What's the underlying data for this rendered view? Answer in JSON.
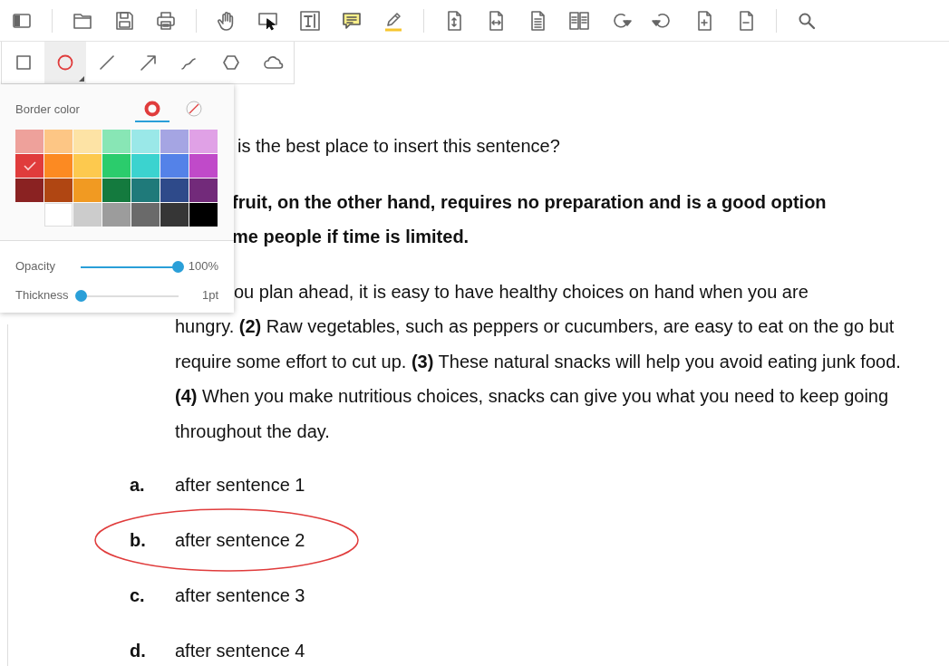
{
  "shape_tools": [
    {
      "kind": "rectangle",
      "selected": false
    },
    {
      "kind": "ellipse",
      "selected": true
    },
    {
      "kind": "line",
      "selected": false
    },
    {
      "kind": "arrow",
      "selected": false
    },
    {
      "kind": "freehand",
      "selected": false
    },
    {
      "kind": "polygon",
      "selected": false
    },
    {
      "kind": "cloud",
      "selected": false
    }
  ],
  "style_popover": {
    "label": "Border color",
    "style_tabs": [
      {
        "kind": "border",
        "selected": true
      },
      {
        "kind": "none",
        "selected": false
      }
    ],
    "swatch_rows": [
      [
        {
          "color": "#eea19b",
          "selected": false
        },
        {
          "color": "#fdc685",
          "selected": false
        },
        {
          "color": "#fde3a5",
          "selected": false
        },
        {
          "color": "#88e6b5",
          "selected": false
        },
        {
          "color": "#9ae8e8",
          "selected": false
        },
        {
          "color": "#a5a5e3",
          "selected": false
        },
        {
          "color": "#e0a1e6",
          "selected": false
        }
      ],
      [
        {
          "color": "#e03c3c",
          "selected": true
        },
        {
          "color": "#fc8a22",
          "selected": false
        },
        {
          "color": "#fdc94e",
          "selected": false
        },
        {
          "color": "#2bcc6c",
          "selected": false
        },
        {
          "color": "#3bd3cf",
          "selected": false
        },
        {
          "color": "#5482e8",
          "selected": false
        },
        {
          "color": "#c04ac9",
          "selected": false
        }
      ],
      [
        {
          "color": "#8a2222",
          "selected": false
        },
        {
          "color": "#b04612",
          "selected": false
        },
        {
          "color": "#f19a22",
          "selected": false
        },
        {
          "color": "#147a3e",
          "selected": false
        },
        {
          "color": "#1f7a7a",
          "selected": false
        },
        {
          "color": "#2e4a8a",
          "selected": false
        },
        {
          "color": "#722a7a",
          "selected": false
        }
      ],
      [
        {
          "color": "#ffffff",
          "selected": false
        },
        {
          "color": "#cccccc",
          "selected": false
        },
        {
          "color": "#9c9c9c",
          "selected": false
        },
        {
          "color": "#6a6a6a",
          "selected": false
        },
        {
          "color": "#363636",
          "selected": false
        },
        {
          "color": "#000000",
          "selected": false
        }
      ]
    ],
    "sliders": [
      {
        "label": "Opacity",
        "level": 1,
        "reading": "100%"
      },
      {
        "label": "Thickness",
        "level": 0,
        "reading": "1pt"
      }
    ]
  },
  "document": {
    "question": "is the best place to insert this sentence?",
    "sentence_lines": [
      "fruit, on the other hand, requires no preparation and is a good option",
      "me people if time is limited."
    ],
    "passage_first_line": "ou plan ahead, it is easy to have healthy choices on hand when you are",
    "passage_rest": "hungry. **(2)** Raw vegetables, such as peppers or cucumbers, are easy to eat on the go but require some effort to cut up. **(3)** These natural snacks will help you avoid eating junk food. **(4)** When you make nutritious choices, snacks can give you what you need to keep going throughout the day.",
    "options": [
      {
        "letter": "a.",
        "text": "after sentence 1",
        "circled": false
      },
      {
        "letter": "b.",
        "text": "after sentence 2",
        "circled": true
      },
      {
        "letter": "c.",
        "text": "after sentence 3",
        "circled": false
      },
      {
        "letter": "d.",
        "text": "after sentence 4",
        "circled": false
      }
    ]
  }
}
